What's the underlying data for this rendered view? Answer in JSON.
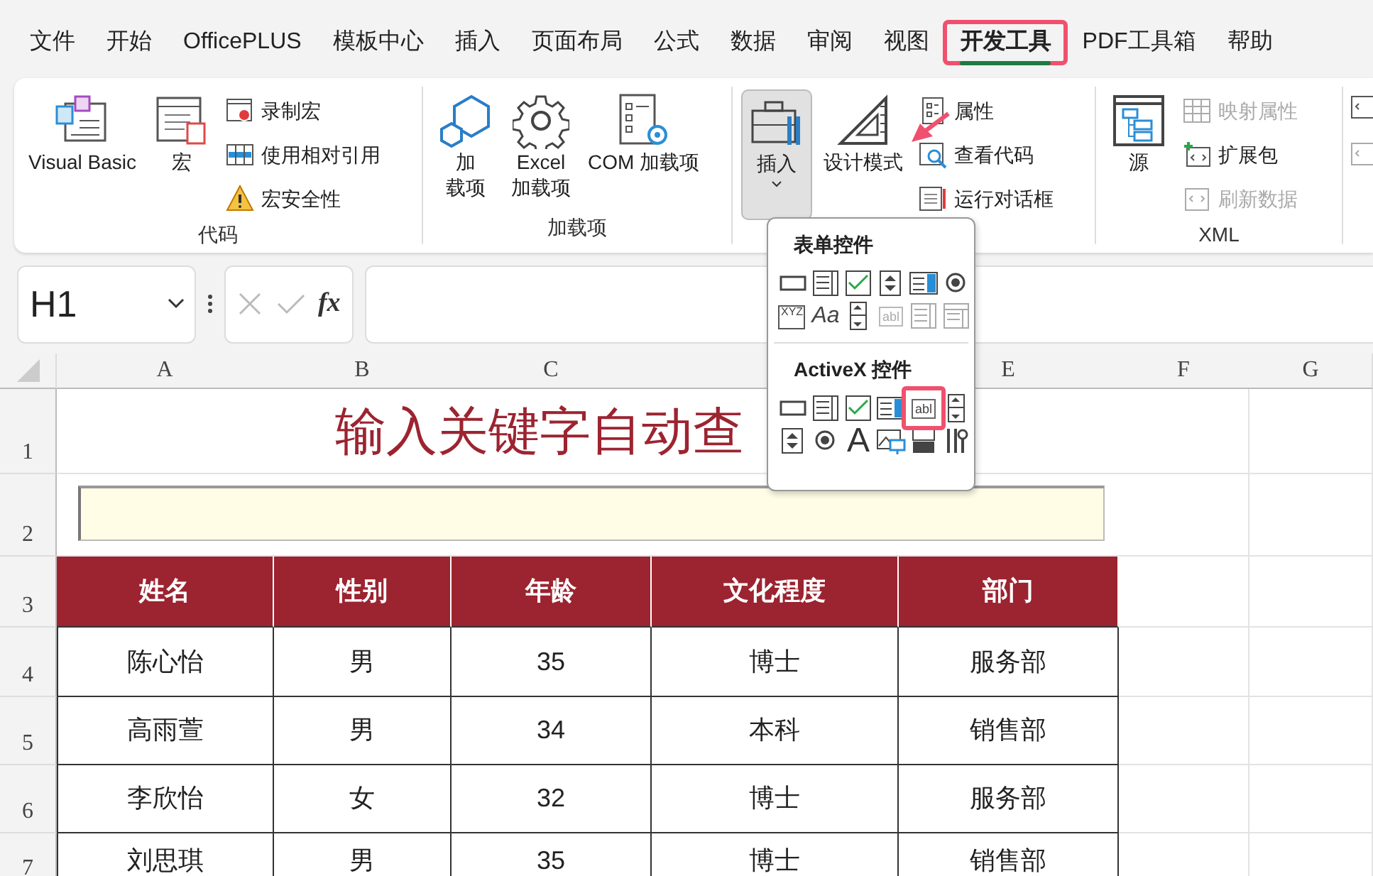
{
  "menu_tabs": [
    {
      "label": "文件",
      "selected": false,
      "highlighted": false
    },
    {
      "label": "开始",
      "selected": false,
      "highlighted": false
    },
    {
      "label": "OfficePLUS",
      "selected": false,
      "highlighted": false
    },
    {
      "label": "模板中心",
      "selected": false,
      "highlighted": false
    },
    {
      "label": "插入",
      "selected": false,
      "highlighted": false
    },
    {
      "label": "页面布局",
      "selected": false,
      "highlighted": false
    },
    {
      "label": "公式",
      "selected": false,
      "highlighted": false
    },
    {
      "label": "数据",
      "selected": false,
      "highlighted": false
    },
    {
      "label": "审阅",
      "selected": false,
      "highlighted": false
    },
    {
      "label": "视图",
      "selected": false,
      "highlighted": false
    },
    {
      "label": "开发工具",
      "selected": true,
      "highlighted": true
    },
    {
      "label": "PDF工具箱",
      "selected": false,
      "highlighted": false
    },
    {
      "label": "帮助",
      "selected": false,
      "highlighted": false
    }
  ],
  "ribbon_groups": [
    {
      "title": "代码",
      "items": [
        {
          "kind": "large",
          "lines": [
            "Visual Basic"
          ],
          "expanded": false,
          "disabled": false
        },
        {
          "kind": "large",
          "lines": [
            "宏"
          ],
          "expanded": false,
          "disabled": false
        },
        {
          "kind": "stack",
          "items": [
            {
              "label": "录制宏",
              "disabled": false
            },
            {
              "label": "使用相对引用",
              "disabled": false
            },
            {
              "label": "宏安全性",
              "disabled": false
            }
          ]
        }
      ]
    },
    {
      "title": "加载项",
      "items": [
        {
          "kind": "large",
          "lines": [
            "加",
            "载项"
          ],
          "expanded": false,
          "disabled": false
        },
        {
          "kind": "large",
          "lines": [
            "Excel",
            "加载项"
          ],
          "expanded": false,
          "disabled": false
        },
        {
          "kind": "large",
          "lines": [
            "COM 加载项"
          ],
          "expanded": false,
          "disabled": false
        }
      ]
    },
    {
      "items": [
        {
          "kind": "large",
          "lines": [
            "插入"
          ],
          "expanded": true,
          "disabled": false
        },
        {
          "kind": "large",
          "lines": [
            "设计模式"
          ],
          "expanded": false,
          "disabled": false
        },
        {
          "kind": "stack",
          "items": [
            {
              "label": "属性",
              "disabled": false
            },
            {
              "label": "查看代码",
              "disabled": false
            },
            {
              "label": "运行对话框",
              "disabled": false
            }
          ]
        }
      ]
    },
    {
      "title": "XML",
      "items": [
        {
          "kind": "large",
          "lines": [
            "源"
          ],
          "expanded": false,
          "disabled": false
        },
        {
          "kind": "stack",
          "items": [
            {
              "label": "映射属性",
              "disabled": true
            },
            {
              "label": "扩展包",
              "disabled": false
            },
            {
              "label": "刷新数据",
              "disabled": true
            }
          ]
        }
      ]
    }
  ],
  "insert_menu": {
    "sections": [
      {
        "title": "表单控件",
        "controls": [
          {
            "kind": "button",
            "disabled": false,
            "highlighted": false
          },
          {
            "kind": "listbox",
            "disabled": false,
            "highlighted": false
          },
          {
            "kind": "checkbox",
            "disabled": false,
            "highlighted": false
          },
          {
            "kind": "spinner",
            "disabled": false,
            "highlighted": false
          },
          {
            "kind": "combo",
            "disabled": false,
            "highlighted": false
          },
          {
            "kind": "radio",
            "disabled": false,
            "highlighted": false
          },
          {
            "kind": "groupbox",
            "glyph": "XYZ",
            "disabled": false,
            "highlighted": false
          },
          {
            "kind": "label",
            "glyph": "Aa",
            "disabled": false,
            "highlighted": false
          },
          {
            "kind": "scrollbar",
            "disabled": false,
            "highlighted": false
          },
          {
            "kind": "textfield",
            "glyph": "abl",
            "disabled": true,
            "highlighted": false
          },
          {
            "kind": "listbox",
            "disabled": true,
            "highlighted": false
          },
          {
            "kind": "combolist",
            "disabled": true,
            "highlighted": false
          }
        ]
      },
      {
        "title": "ActiveX 控件",
        "controls": [
          {
            "kind": "button",
            "disabled": false,
            "highlighted": false
          },
          {
            "kind": "listbox",
            "disabled": false,
            "highlighted": false
          },
          {
            "kind": "checkbox",
            "disabled": false,
            "highlighted": false
          },
          {
            "kind": "combo",
            "disabled": false,
            "highlighted": false
          },
          {
            "kind": "textfield",
            "glyph": "abl",
            "disabled": false,
            "highlighted": true
          },
          {
            "kind": "scrollbar",
            "disabled": false,
            "highlighted": false
          },
          {
            "kind": "spinner",
            "disabled": false,
            "highlighted": false
          },
          {
            "kind": "radio",
            "disabled": false,
            "highlighted": false
          },
          {
            "kind": "label",
            "glyph": "A",
            "disabled": false,
            "highlighted": false
          },
          {
            "kind": "image",
            "disabled": false,
            "highlighted": false
          },
          {
            "kind": "toggle",
            "disabled": false,
            "highlighted": false
          },
          {
            "kind": "more",
            "disabled": false,
            "highlighted": false
          }
        ]
      }
    ]
  },
  "formula_bar": {
    "name_box": "H1",
    "fx": "fx"
  },
  "sheet": {
    "column_headers": [
      "A",
      "B",
      "C",
      "E",
      "F",
      "G"
    ],
    "row_headers": [
      "1",
      "2",
      "3",
      "4",
      "5",
      "6",
      "7"
    ],
    "title": "输入关键字自动查",
    "table": {
      "columns": [
        "姓名",
        "性别",
        "年龄",
        "文化程度",
        "部门"
      ],
      "rows": [
        [
          "陈心怡",
          "男",
          "35",
          "博士",
          "服务部"
        ],
        [
          "高雨萱",
          "男",
          "34",
          "本科",
          "销售部"
        ],
        [
          "李欣怡",
          "女",
          "32",
          "博士",
          "服务部"
        ],
        [
          "刘思琪",
          "男",
          "35",
          "博士",
          "销售部"
        ]
      ]
    }
  }
}
